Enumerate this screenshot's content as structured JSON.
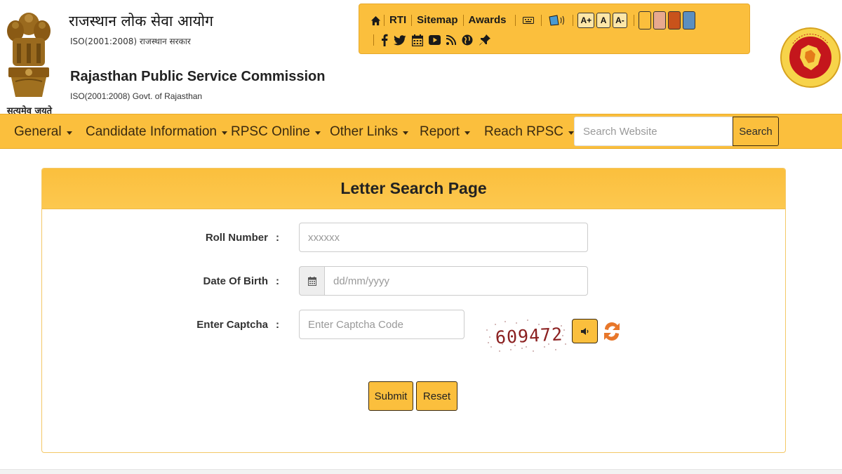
{
  "header": {
    "emblem_caption": "सत्यमेव जयते",
    "title_hindi": "राजस्थान लोक सेवा आयोग",
    "sub_hindi": "ISO(2001:2008) राजस्थान सरकार",
    "title_english": "Rajasthan Public Service Commission",
    "sub_english": "ISO(2001:2008) Govt. of Rajasthan"
  },
  "utility": {
    "links": [
      "RTI",
      "Sitemap",
      "Awards"
    ],
    "font_buttons": [
      "A+",
      "A",
      "A-"
    ],
    "theme_colors": [
      "#fbbf3d",
      "#e8a98f",
      "#c9531b",
      "#5b8fc0"
    ],
    "social_icons": [
      "facebook-icon",
      "twitter-icon",
      "calendar-icon",
      "youtube-icon",
      "rss-icon",
      "globe-icon",
      "pin-icon"
    ]
  },
  "nav": {
    "items": [
      "General",
      "Candidate Information",
      "RPSC Online",
      "Other Links",
      "Report",
      "Reach RPSC"
    ],
    "search_placeholder": "Search Website",
    "search_label": "Search"
  },
  "form": {
    "title": "Letter Search Page",
    "roll_label": "Roll Number",
    "roll_placeholder": "xxxxxx",
    "dob_label": "Date Of Birth",
    "dob_placeholder": "dd/mm/yyyy",
    "captcha_label": "Enter Captcha",
    "captcha_placeholder": "Enter Captcha Code",
    "captcha_text": "609472",
    "colon": ":",
    "submit_label": "Submit",
    "reset_label": "Reset"
  },
  "colors": {
    "accent": "#fbbf3d",
    "border_dark": "#3a2a10"
  }
}
